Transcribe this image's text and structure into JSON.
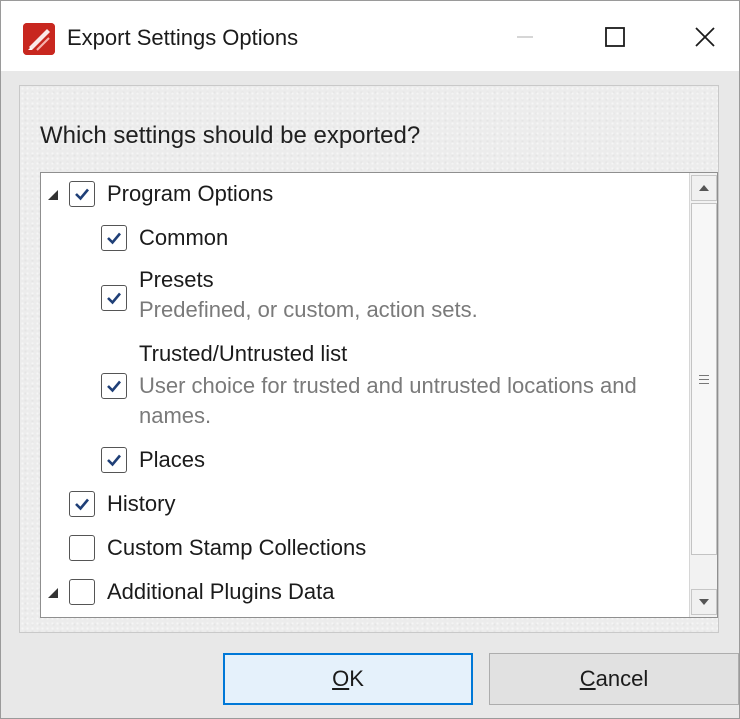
{
  "window": {
    "title": "Export Settings Options"
  },
  "prompt": "Which settings should be exported?",
  "tree": [
    {
      "label": "Program Options",
      "checked": true,
      "expanded": true
    },
    {
      "label": "Common",
      "checked": true
    },
    {
      "label": "Presets",
      "checked": true,
      "description": "Predefined, or custom, action sets."
    },
    {
      "label": "Trusted/Untrusted list",
      "checked": true,
      "description_line1": "User choice for trusted and untrusted locations and",
      "description_line2": "names."
    },
    {
      "label": "Places",
      "checked": true
    },
    {
      "label": "History",
      "checked": true
    },
    {
      "label": "Custom Stamp Collections",
      "checked": false
    },
    {
      "label": "Additional Plugins Data",
      "checked": false,
      "expanded": true
    }
  ],
  "buttons": {
    "ok_mnemonic": "O",
    "ok_rest": "K",
    "cancel_mnemonic": "C",
    "cancel_rest": "ancel"
  },
  "colors": {
    "accent": "#0078d7",
    "app_icon": "#c8271f",
    "check": "#1f3f77"
  },
  "icons": [
    "app-logo-icon",
    "minimize-icon",
    "maximize-icon",
    "close-icon",
    "expand-arrow-icon",
    "checkmark-icon",
    "scroll-up-icon",
    "scroll-down-icon",
    "scroll-grip-icon"
  ]
}
